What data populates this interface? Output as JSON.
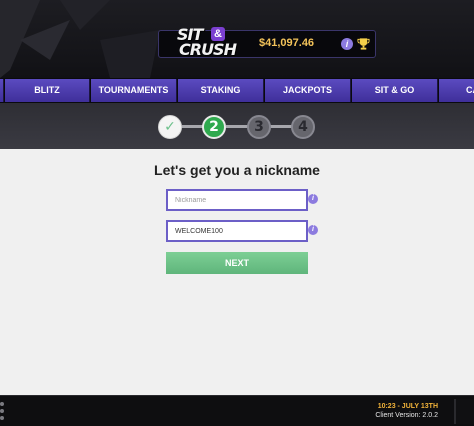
{
  "header": {
    "logo": {
      "line1": "SIT",
      "amp": "&",
      "line2": "CRUSH"
    },
    "balance": "$41,097.46",
    "info_icon": "info-icon",
    "trophy_icon": "trophy-icon"
  },
  "nav": {
    "tabs": [
      {
        "label": "BLITZ"
      },
      {
        "label": "TOURNAMENTS"
      },
      {
        "label": "STAKING"
      },
      {
        "label": "JACKPOTS"
      },
      {
        "label": "SIT & GO"
      },
      {
        "label": "CA"
      }
    ]
  },
  "stepper": {
    "steps": [
      {
        "label": "✓",
        "state": "done"
      },
      {
        "label": "2",
        "state": "active"
      },
      {
        "label": "3",
        "state": "todo"
      },
      {
        "label": "4",
        "state": "todo"
      }
    ]
  },
  "form": {
    "heading": "Let's get you a nickname",
    "nickname": {
      "placeholder": "Nickname",
      "value": ""
    },
    "promo": {
      "value": "WELCOME100"
    },
    "info_icon_label": "i",
    "next_label": "NEXT"
  },
  "footer": {
    "time": "10:23 - JULY 13TH",
    "version": "Client Version: 2.0.2"
  },
  "colors": {
    "accent": "#5b4bc0",
    "balance": "#f3c35a",
    "active_step": "#2fa94e",
    "next_button": "#6cc28a"
  }
}
